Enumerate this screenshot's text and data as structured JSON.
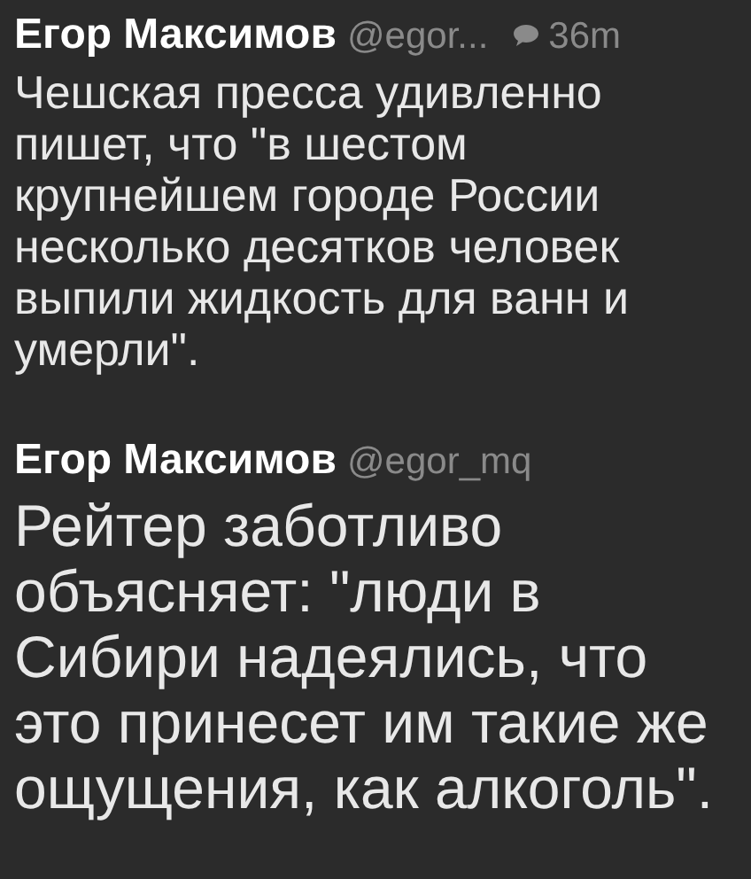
{
  "tweets": [
    {
      "author": "Егор Максимов",
      "handle": "@egor...",
      "has_reply": true,
      "time": "36m",
      "kind": "normal",
      "text": "Чешская пресса удивленно пишет, что \"в шестом крупнейшем городе России несколько десятков человек выпили жидкость для ванн и умерли\"."
    },
    {
      "author": "Егор Максимов",
      "handle": "@egor_mq",
      "has_reply": false,
      "kind": "large",
      "text": "Рейтер заботливо объясняет: \"люди в Сибири надеялись, что это принесет им такие же ощущения, как алкоголь\"."
    }
  ]
}
